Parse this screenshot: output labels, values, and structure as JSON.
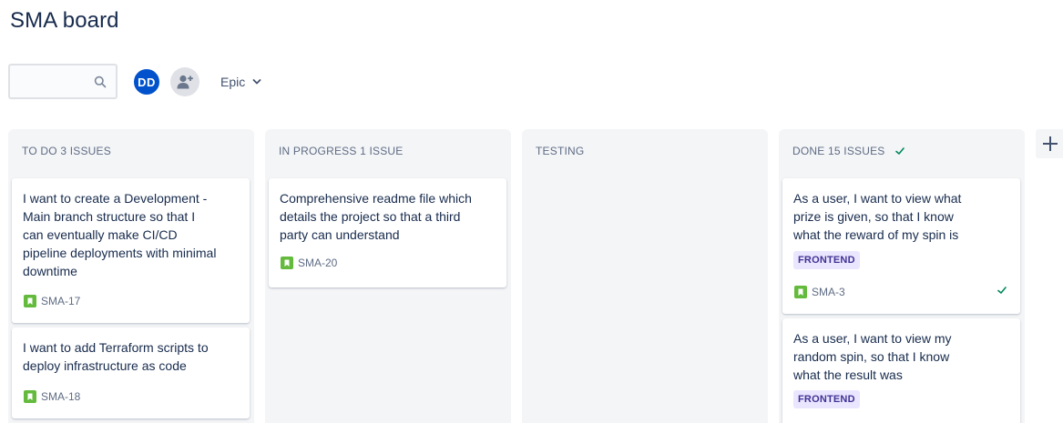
{
  "board": {
    "title": "SMA board"
  },
  "toolbar": {
    "search_placeholder": "",
    "avatar_initials": "DD",
    "epic_filter_label": "Epic"
  },
  "columns": [
    {
      "header": "TO DO 3 ISSUES",
      "cards": [
        {
          "text": "I want to create a Development - Main branch structure so that I can eventually make CI/CD pipeline deployments with minimal downtime",
          "key": "SMA-17",
          "icon": "story-icon"
        },
        {
          "text": "I want to add Terraform scripts to deploy infrastructure as code",
          "key": "SMA-18",
          "icon": "story-icon"
        }
      ]
    },
    {
      "header": "IN PROGRESS 1 ISSUE",
      "cards": [
        {
          "text": "Comprehensive readme file which details the project so that a third party can understand",
          "key": "SMA-20",
          "icon": "story-icon"
        }
      ]
    },
    {
      "header": "TESTING",
      "cards": []
    },
    {
      "header": "DONE 15 ISSUES",
      "cards": [
        {
          "text": "As a user, I want to view what prize is given, so that I know what the reward of my spin is",
          "label": "FRONTEND",
          "key": "SMA-3",
          "icon": "story-icon"
        },
        {
          "text": "As a user, I want to view my random spin, so that I know what the result was",
          "label": "FRONTEND"
        }
      ]
    }
  ],
  "colors": {
    "accent": "#0052cc",
    "story": "#63ba3c",
    "done": "#00875a",
    "label_bg": "#eae6ff",
    "label_fg": "#403294"
  }
}
